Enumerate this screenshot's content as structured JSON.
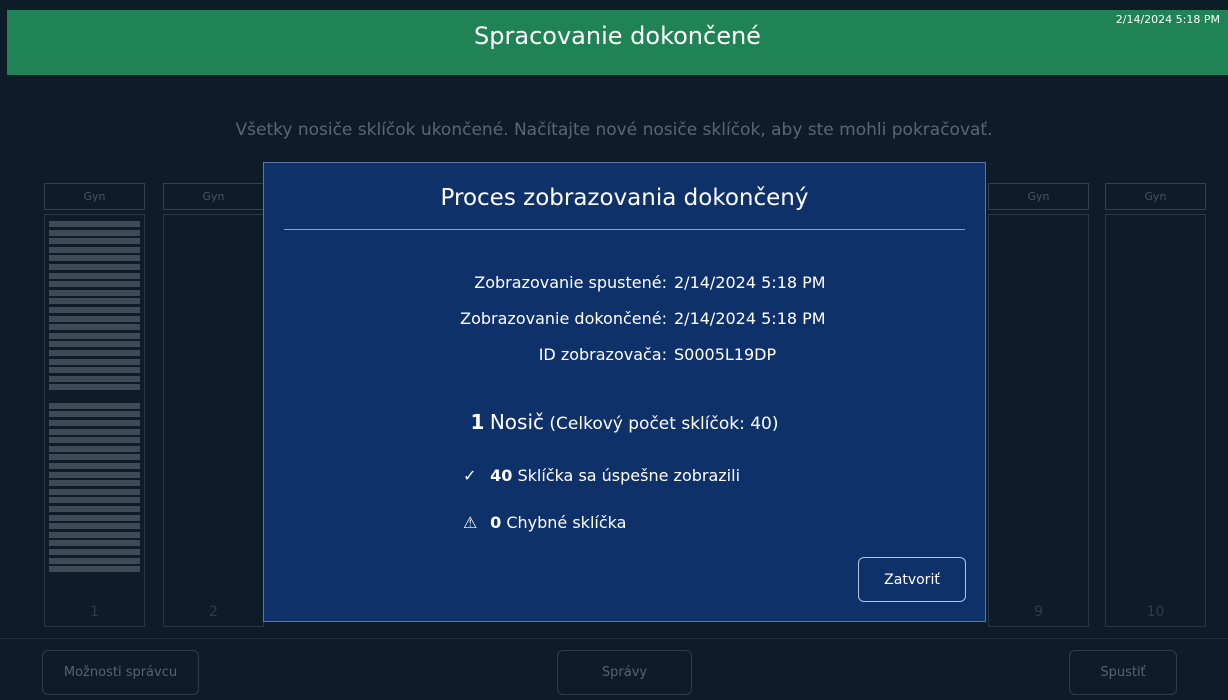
{
  "header": {
    "title": "Spracovanie dokončené",
    "datetime": "2/14/2024 5:18 PM"
  },
  "message": "Všetky nosiče sklíčok ukončené. Načítajte nové nosiče sklíčok, aby ste mohli pokračovať.",
  "carriers": [
    {
      "label": "Gyn",
      "number": "1"
    },
    {
      "label": "Gyn",
      "number": "2"
    },
    {
      "label": "Gyn",
      "number": "9"
    },
    {
      "label": "Gyn",
      "number": "10"
    }
  ],
  "footer": {
    "admin_options": "Možnosti správcu",
    "reports": "Správy",
    "start": "Spustiť"
  },
  "modal": {
    "title": "Proces zobrazovania dokončený",
    "imaging_started_label": "Zobrazovanie spustené:",
    "imaging_started_value": "2/14/2024 5:18 PM",
    "imaging_completed_label": "Zobrazovanie dokončené:",
    "imaging_completed_value": "2/14/2024 5:18 PM",
    "imager_id_label": "ID zobrazovača:",
    "imager_id_value": "S0005L19DP",
    "carrier_count": "1",
    "carrier_word": "Nosič",
    "total_slides": "(Celkový počet sklíčok: 40)",
    "success_count": "40",
    "success_text": "Sklíčka sa úspešne zobrazili",
    "error_count": "0",
    "error_text": "Chybné sklíčka",
    "close_label": "Zatvoriť"
  },
  "colors": {
    "header": "#1f8356",
    "background": "#0e1c29",
    "modal": "#0f3169"
  },
  "icons": {
    "success": "check-icon",
    "error": "warning-icon"
  }
}
